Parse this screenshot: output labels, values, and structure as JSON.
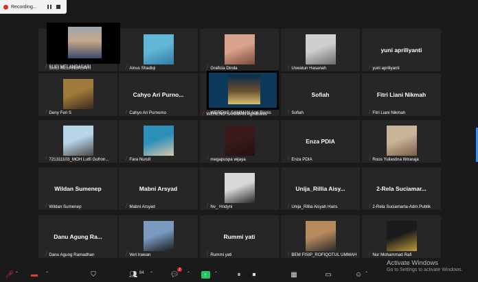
{
  "recording": {
    "label": "Recording..."
  },
  "participants": [
    {
      "id": "r1c1",
      "name": "SUCI MELANDASARI",
      "muted": true,
      "type": "video"
    },
    {
      "id": "r1c2",
      "name": "Ainus Shadiqi",
      "muted": true,
      "type": "photo"
    },
    {
      "id": "r1c3",
      "name": "Graficia Dinda",
      "muted": true,
      "type": "photo"
    },
    {
      "id": "r1c4",
      "name": "Uswatun Hasanah",
      "muted": true,
      "type": "photo"
    },
    {
      "id": "r1c5",
      "name": "yuni apriliyanti",
      "display": "yuni apriliyanti",
      "muted": true,
      "type": "text"
    },
    {
      "id": "r2c1",
      "name": "Deny Feri S",
      "muted": true,
      "type": "photo"
    },
    {
      "id": "r2c2",
      "name": "Cahyo Ari Purnomo",
      "display": "Cahyo  Ari  Purno...",
      "muted": true,
      "type": "text"
    },
    {
      "id": "r2c3",
      "name": "WERENG SANIMAN Agri Bisnis",
      "muted": true,
      "type": "video"
    },
    {
      "id": "r2c4",
      "name": "Sofiah",
      "display": "Sofiah",
      "muted": true,
      "type": "text"
    },
    {
      "id": "r2c5",
      "name": "Fitri Liani Nikmah",
      "display": "Fitri Liani Nikmah",
      "muted": true,
      "type": "text"
    },
    {
      "id": "r3c1",
      "name": "721311103_MOH Lutfi Gufron...",
      "muted": true,
      "type": "photo"
    },
    {
      "id": "r3c2",
      "name": "Fara Nurull",
      "muted": true,
      "type": "photo"
    },
    {
      "id": "r3c3",
      "name": "megapuspa wijaya",
      "muted": true,
      "type": "photo"
    },
    {
      "id": "r3c4",
      "name": "Enza PDIA",
      "display": "Enza PDIA",
      "muted": true,
      "type": "text"
    },
    {
      "id": "r3c5",
      "name": "Roos Yuliastina Wiraraja",
      "muted": true,
      "type": "photo"
    },
    {
      "id": "r4c1",
      "name": "Wildan Sumenep",
      "display": "Wildan  Sumenep",
      "muted": true,
      "type": "text"
    },
    {
      "id": "r4c2",
      "name": "Mabni Arsyad",
      "display": "Mabni  Arsyad",
      "muted": true,
      "type": "text"
    },
    {
      "id": "r4c3",
      "name": "Nv_ Hndyni",
      "muted": true,
      "type": "photo"
    },
    {
      "id": "r4c4",
      "name": "Unija_Rillia Aisyah Haris",
      "display": "Unija_Rillia   Aisy...",
      "muted": true,
      "type": "text"
    },
    {
      "id": "r4c5",
      "name": "2-Rela Suciamarta-Adm.Publik",
      "display": "2-Rela   Suciamar...",
      "muted": true,
      "type": "text"
    },
    {
      "id": "r5c1",
      "name": "Danu Agung Ramadhan",
      "display": "Danu  Agung  Ra...",
      "muted": true,
      "type": "text"
    },
    {
      "id": "r5c2",
      "name": "Veri Irawan",
      "muted": true,
      "type": "photo"
    },
    {
      "id": "r5c3",
      "name": "Rummi yati",
      "display": "Rummi yati",
      "muted": true,
      "type": "text"
    },
    {
      "id": "r5c4",
      "name": "BEM FISIP_ROFIQOTUL UMMAH",
      "muted": true,
      "type": "photo"
    },
    {
      "id": "r5c5",
      "name": "Nur Mohammad Rafi",
      "muted": true,
      "type": "photo"
    }
  ],
  "toolbar": {
    "participants_count": "84",
    "chat_badge": "2"
  },
  "watermark": {
    "title": "Activate Windows",
    "subtitle": "Go to Settings to activate Windows."
  },
  "colors": {
    "accent": "#2d8cff",
    "muted_mic": "#e03e36",
    "background": "#1a1a1a",
    "tile": "#262626"
  }
}
